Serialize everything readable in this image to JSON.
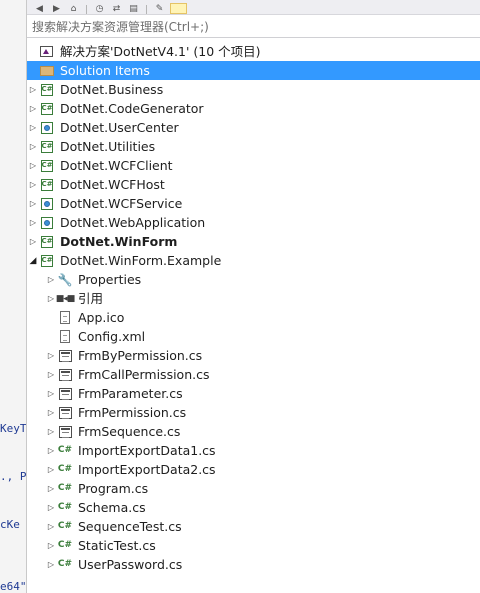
{
  "search": {
    "placeholder": "搜索解决方案资源管理器(Ctrl+;)"
  },
  "code_fragments": [
    "KeyT",
    "., P",
    "cKe",
    "e64\""
  ],
  "solution": {
    "label": "解决方案'DotNetV4.1' (10 个项目)"
  },
  "tree": [
    {
      "label": "Solution Items",
      "icon": "folder-icon",
      "arrow": "",
      "selected": true,
      "bold": false,
      "indent": 0
    },
    {
      "label": "DotNet.Business",
      "icon": "csharp-project-icon",
      "arrow": "collapsed",
      "bold": false,
      "indent": 0
    },
    {
      "label": "DotNet.CodeGenerator",
      "icon": "csharp-project-icon",
      "arrow": "collapsed",
      "bold": false,
      "indent": 0
    },
    {
      "label": "DotNet.UserCenter",
      "icon": "web-project-icon",
      "arrow": "collapsed",
      "bold": false,
      "indent": 0
    },
    {
      "label": "DotNet.Utilities",
      "icon": "csharp-project-icon",
      "arrow": "collapsed",
      "bold": false,
      "indent": 0
    },
    {
      "label": "DotNet.WCFClient",
      "icon": "csharp-project-icon",
      "arrow": "collapsed",
      "bold": false,
      "indent": 0
    },
    {
      "label": "DotNet.WCFHost",
      "icon": "csharp-project-icon",
      "arrow": "collapsed",
      "bold": false,
      "indent": 0
    },
    {
      "label": "DotNet.WCFService",
      "icon": "web-project-icon",
      "arrow": "collapsed",
      "bold": false,
      "indent": 0
    },
    {
      "label": "DotNet.WebApplication",
      "icon": "web-project-icon",
      "arrow": "collapsed",
      "bold": false,
      "indent": 0
    },
    {
      "label": "DotNet.WinForm",
      "icon": "csharp-project-icon",
      "arrow": "collapsed",
      "bold": true,
      "indent": 0
    },
    {
      "label": "DotNet.WinForm.Example",
      "icon": "csharp-project-icon",
      "arrow": "expanded",
      "bold": false,
      "indent": 0
    },
    {
      "label": "Properties",
      "icon": "wrench-icon",
      "arrow": "collapsed",
      "bold": false,
      "indent": 1
    },
    {
      "label": "引用",
      "icon": "references-icon",
      "arrow": "collapsed",
      "bold": false,
      "indent": 1
    },
    {
      "label": "App.ico",
      "icon": "ico-file-icon",
      "arrow": "",
      "bold": false,
      "indent": 1
    },
    {
      "label": "Config.xml",
      "icon": "xml-file-icon",
      "arrow": "",
      "bold": false,
      "indent": 1
    },
    {
      "label": "FrmByPermission.cs",
      "icon": "form-icon",
      "arrow": "collapsed",
      "bold": false,
      "indent": 1
    },
    {
      "label": "FrmCallPermission.cs",
      "icon": "form-icon",
      "arrow": "collapsed",
      "bold": false,
      "indent": 1
    },
    {
      "label": "FrmParameter.cs",
      "icon": "form-icon",
      "arrow": "collapsed",
      "bold": false,
      "indent": 1
    },
    {
      "label": "FrmPermission.cs",
      "icon": "form-icon",
      "arrow": "collapsed",
      "bold": false,
      "indent": 1
    },
    {
      "label": "FrmSequence.cs",
      "icon": "form-icon",
      "arrow": "collapsed",
      "bold": false,
      "indent": 1
    },
    {
      "label": "ImportExportData1.cs",
      "icon": "csharp-file-icon",
      "arrow": "collapsed",
      "bold": false,
      "indent": 1
    },
    {
      "label": "ImportExportData2.cs",
      "icon": "csharp-file-icon",
      "arrow": "collapsed",
      "bold": false,
      "indent": 1
    },
    {
      "label": "Program.cs",
      "icon": "csharp-file-icon",
      "arrow": "collapsed",
      "bold": false,
      "indent": 1
    },
    {
      "label": "Schema.cs",
      "icon": "csharp-file-icon",
      "arrow": "collapsed",
      "bold": false,
      "indent": 1
    },
    {
      "label": "SequenceTest.cs",
      "icon": "csharp-file-icon",
      "arrow": "collapsed",
      "bold": false,
      "indent": 1
    },
    {
      "label": "StaticTest.cs",
      "icon": "csharp-file-icon",
      "arrow": "collapsed",
      "bold": false,
      "indent": 1
    },
    {
      "label": "UserPassword.cs",
      "icon": "csharp-file-icon",
      "arrow": "collapsed",
      "bold": false,
      "indent": 1
    }
  ],
  "colors": {
    "selection": "#3399ff",
    "csharp": "#3a7d3a",
    "folder": "#dcb67a"
  }
}
